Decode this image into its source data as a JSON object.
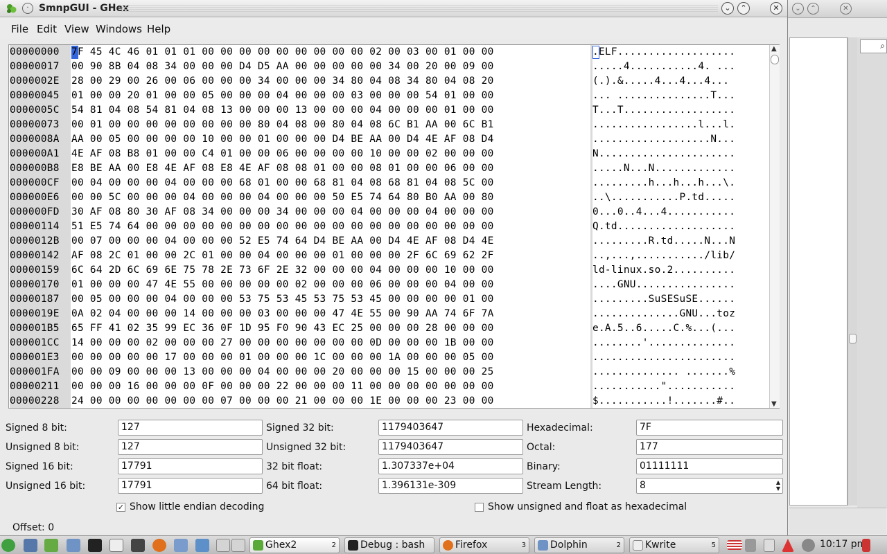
{
  "window": {
    "title": "SmnpGUI - GHex"
  },
  "menu": [
    "File",
    "Edit",
    "View",
    "Windows",
    "Help"
  ],
  "hex": {
    "rows": [
      {
        "off": "00000000",
        "hex": "7F 45 4C 46 01 01 01 00 00 00 00 00 00 00 00 00 02 00 03 00 01 00 00",
        "ascii": ".ELF..................."
      },
      {
        "off": "00000017",
        "hex": "00 90 8B 04 08 34 00 00 00 D4 D5 AA 00 00 00 00 00 34 00 20 00 09 00",
        "ascii": ".....4...........4. ..."
      },
      {
        "off": "0000002E",
        "hex": "28 00 29 00 26 00 06 00 00 00 34 00 00 00 34 80 04 08 34 80 04 08 20",
        "ascii": "(.).&.....4...4...4... "
      },
      {
        "off": "00000045",
        "hex": "01 00 00 20 01 00 00 05 00 00 00 04 00 00 00 03 00 00 00 54 01 00 00",
        "ascii": "... ...............T..."
      },
      {
        "off": "0000005C",
        "hex": "54 81 04 08 54 81 04 08 13 00 00 00 13 00 00 00 04 00 00 00 01 00 00",
        "ascii": "T...T.................."
      },
      {
        "off": "00000073",
        "hex": "00 01 00 00 00 00 00 00 00 00 80 04 08 00 80 04 08 6C B1 AA 00 6C B1",
        "ascii": ".................l...l."
      },
      {
        "off": "0000008A",
        "hex": "AA 00 05 00 00 00 00 10 00 00 01 00 00 00 D4 BE AA 00 D4 4E AF 08 D4",
        "ascii": "...................N..."
      },
      {
        "off": "000000A1",
        "hex": "4E AF 08 B8 01 00 00 C4 01 00 00 06 00 00 00 00 10 00 00 02 00 00 00",
        "ascii": "N......................"
      },
      {
        "off": "000000B8",
        "hex": "E8 BE AA 00 E8 4E AF 08 E8 4E AF 08 08 01 00 00 08 01 00 00 06 00 00",
        "ascii": ".....N...N............."
      },
      {
        "off": "000000CF",
        "hex": "00 04 00 00 00 04 00 00 00 68 01 00 00 68 81 04 08 68 81 04 08 5C 00",
        "ascii": ".........h...h...h...\\."
      },
      {
        "off": "000000E6",
        "hex": "00 00 5C 00 00 00 04 00 00 00 04 00 00 00 50 E5 74 64 80 B0 AA 00 80",
        "ascii": "..\\...........P.td....."
      },
      {
        "off": "000000FD",
        "hex": "30 AF 08 80 30 AF 08 34 00 00 00 34 00 00 00 04 00 00 00 04 00 00 00",
        "ascii": "0...0..4...4..........."
      },
      {
        "off": "00000114",
        "hex": "51 E5 74 64 00 00 00 00 00 00 00 00 00 00 00 00 00 00 00 00 00 00 00",
        "ascii": "Q.td..................."
      },
      {
        "off": "0000012B",
        "hex": "00 07 00 00 00 04 00 00 00 52 E5 74 64 D4 BE AA 00 D4 4E AF 08 D4 4E",
        "ascii": ".........R.td.....N...N"
      },
      {
        "off": "00000142",
        "hex": "AF 08 2C 01 00 00 2C 01 00 00 04 00 00 00 01 00 00 00 2F 6C 69 62 2F",
        "ascii": "..,...,.........../lib/"
      },
      {
        "off": "00000159",
        "hex": "6C 64 2D 6C 69 6E 75 78 2E 73 6F 2E 32 00 00 00 04 00 00 00 10 00 00",
        "ascii": "ld-linux.so.2.........."
      },
      {
        "off": "00000170",
        "hex": "01 00 00 00 47 4E 55 00 00 00 00 00 02 00 00 00 06 00 00 00 04 00 00",
        "ascii": "....GNU................"
      },
      {
        "off": "00000187",
        "hex": "00 05 00 00 00 04 00 00 00 53 75 53 45 53 75 53 45 00 00 00 00 01 00",
        "ascii": ".........SuSESuSE......"
      },
      {
        "off": "0000019E",
        "hex": "0A 02 04 00 00 00 14 00 00 00 03 00 00 00 47 4E 55 00 90 AA 74 6F 7A",
        "ascii": "..............GNU...toz"
      },
      {
        "off": "000001B5",
        "hex": "65 FF 41 02 35 99 EC 36 0F 1D 95 F0 90 43 EC 25 00 00 00 28 00 00 00",
        "ascii": "e.A.5..6.....C.%...(..."
      },
      {
        "off": "000001CC",
        "hex": "14 00 00 00 02 00 00 00 27 00 00 00 00 00 00 00 0D 00 00 00 1B 00 00",
        "ascii": "........'.............."
      },
      {
        "off": "000001E3",
        "hex": "00 00 00 00 00 17 00 00 00 01 00 00 00 1C 00 00 00 1A 00 00 00 05 00",
        "ascii": "......................."
      },
      {
        "off": "000001FA",
        "hex": "00 00 09 00 00 00 13 00 00 00 04 00 00 00 20 00 00 00 15 00 00 00 25",
        "ascii": ".............. .......%"
      },
      {
        "off": "00000211",
        "hex": "00 00 00 16 00 00 00 0F 00 00 00 22 00 00 00 11 00 00 00 00 00 00 00",
        "ascii": "...........\"..........."
      },
      {
        "off": "00000228",
        "hex": "24 00 00 00 00 00 00 00 07 00 00 00 21 00 00 00 1E 00 00 00 23 00 00",
        "ascii": "$...........!.......#.."
      }
    ]
  },
  "converter": {
    "signed8_label": "Signed 8 bit:",
    "signed8": "127",
    "unsigned8_label": "Unsigned 8 bit:",
    "unsigned8": "127",
    "signed16_label": "Signed 16 bit:",
    "signed16": "17791",
    "unsigned16_label": "Unsigned 16 bit:",
    "unsigned16": "17791",
    "signed32_label": "Signed 32 bit:",
    "signed32": "1179403647",
    "unsigned32_label": "Unsigned 32 bit:",
    "unsigned32": "1179403647",
    "float32_label": "32 bit float:",
    "float32": "1.307337e+04",
    "float64_label": "64 bit float:",
    "float64": "1.396131e-309",
    "hex_label": "Hexadecimal:",
    "hex": "7F",
    "octal_label": "Octal:",
    "octal": "177",
    "binary_label": "Binary:",
    "binary": "01111111",
    "stream_label": "Stream Length:",
    "stream": "8",
    "little_endian_label": "Show little endian decoding",
    "little_endian_checked": true,
    "unsigned_hex_label": "Show unsigned and float as hexadecimal",
    "unsigned_hex_checked": false
  },
  "status": {
    "offset": "Offset: 0"
  },
  "taskbar": {
    "tasks": [
      {
        "label": "Ghex2",
        "count": "2"
      },
      {
        "label": "Debug : bash",
        "count": ""
      },
      {
        "label": "Firefox",
        "count": "3"
      },
      {
        "label": "Dolphin",
        "count": "2"
      },
      {
        "label": "Kwrite",
        "count": "5"
      }
    ],
    "clock": "10:17 pm"
  },
  "colors": {
    "selection": "#3366dd",
    "offset_bg": "#dadada"
  }
}
